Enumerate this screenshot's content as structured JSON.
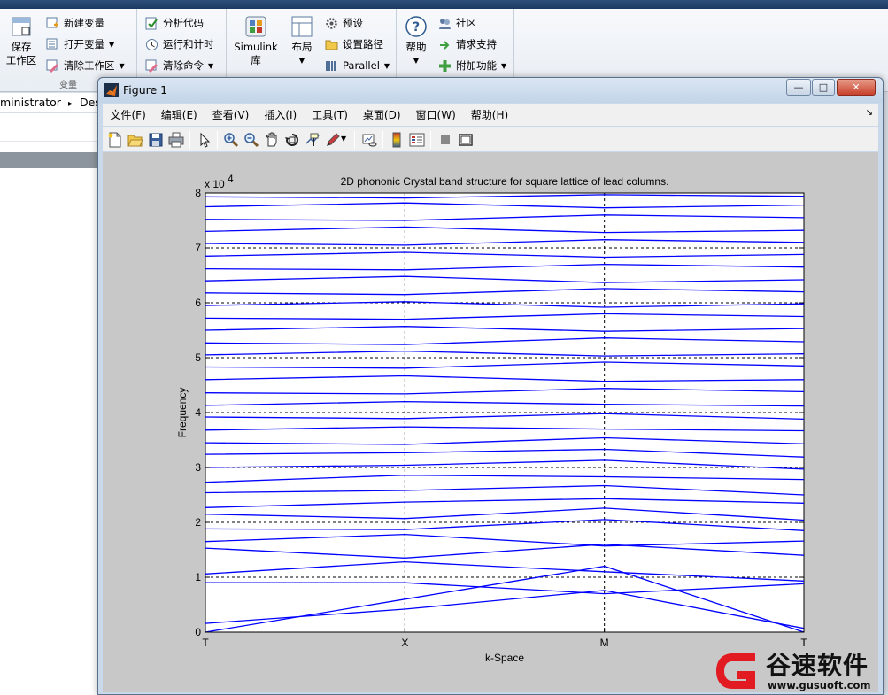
{
  "ribbon": {
    "save_workspace": "保存\n工作区",
    "new_variable": "新建变量",
    "open_variable": "打开变量",
    "clear_workspace": "清除工作区",
    "variable_group": "变量",
    "analyze_code": "分析代码",
    "run_and_time": "运行和计时",
    "clear_commands": "清除命令",
    "simulink": "Simulink",
    "simulink_lib": "库",
    "layout": "布局",
    "preferences": "预设",
    "set_path": "设置路径",
    "parallel": "Parallel",
    "help": "帮助",
    "community": "社区",
    "request_support": "请求支持",
    "addons": "附加功能"
  },
  "address": {
    "user": "ministrator",
    "separator": "▸",
    "folder": "Desk"
  },
  "figure": {
    "title": "Figure 1",
    "controls": {
      "minimize": "—",
      "maximize": "□",
      "close": "✕"
    },
    "menu": [
      "文件(F)",
      "编辑(E)",
      "查看(V)",
      "插入(I)",
      "工具(T)",
      "桌面(D)",
      "窗口(W)",
      "帮助(H)"
    ]
  },
  "icons": {
    "toolbar": [
      "new-figure-icon",
      "open-file-icon",
      "save-icon",
      "print-icon",
      "pointer-icon",
      "zoom-in-icon",
      "zoom-out-icon",
      "pan-icon",
      "rotate-3d-icon",
      "data-cursor-icon",
      "brush-icon",
      "link-plot-icon",
      "colorbar-icon",
      "legend-icon",
      "hide-tools-icon",
      "show-tools-icon"
    ]
  },
  "chart_data": {
    "type": "line",
    "title": "2D phononic Crystal band structure for square lattice of lead columns.",
    "xlabel": "k-Space",
    "ylabel": "Frequency",
    "y_exponent_label": "x 10",
    "y_exponent": "4",
    "x_ticks": [
      "T",
      "X",
      "M",
      "T"
    ],
    "y_ticks": [
      "0",
      "1",
      "2",
      "3",
      "4",
      "5",
      "6",
      "7",
      "8"
    ],
    "ylim": [
      0,
      80000
    ],
    "grid": true,
    "line_color": "#0000ff",
    "series": [
      {
        "values": [
          0,
          6000,
          12000,
          0
        ]
      },
      {
        "values": [
          1600,
          4200,
          7600,
          700
        ]
      },
      {
        "values": [
          9000,
          9000,
          7000,
          8800
        ]
      },
      {
        "values": [
          10600,
          12800,
          11000,
          9300
        ]
      },
      {
        "values": [
          15300,
          13500,
          16000,
          14000
        ]
      },
      {
        "values": [
          16500,
          17800,
          15700,
          16600
        ]
      },
      {
        "values": [
          18800,
          18700,
          20500,
          18500
        ]
      },
      {
        "values": [
          21500,
          20700,
          22600,
          20400
        ]
      },
      {
        "values": [
          22700,
          23700,
          24300,
          23500
        ]
      },
      {
        "values": [
          25400,
          25800,
          26700,
          25000
        ]
      },
      {
        "values": [
          27300,
          28600,
          28300,
          27800
        ]
      },
      {
        "values": [
          30000,
          30400,
          31300,
          29700
        ]
      },
      {
        "values": [
          32400,
          32700,
          33300,
          31900
        ]
      },
      {
        "values": [
          34500,
          34200,
          35400,
          34300
        ]
      },
      {
        "values": [
          36800,
          37400,
          37000,
          36700
        ]
      },
      {
        "values": [
          39200,
          38900,
          39800,
          38800
        ]
      },
      {
        "values": [
          41300,
          42000,
          41500,
          41200
        ]
      },
      {
        "values": [
          43600,
          43400,
          44400,
          43800
        ]
      },
      {
        "values": [
          46000,
          46700,
          45700,
          46000
        ]
      },
      {
        "values": [
          48300,
          48100,
          49200,
          48500
        ]
      },
      {
        "values": [
          50500,
          51200,
          50300,
          50700
        ]
      },
      {
        "values": [
          52700,
          52400,
          53600,
          52900
        ]
      },
      {
        "values": [
          55000,
          55700,
          54800,
          55300
        ]
      },
      {
        "values": [
          57200,
          57000,
          58000,
          57500
        ]
      },
      {
        "values": [
          59500,
          60200,
          59200,
          59800
        ]
      },
      {
        "values": [
          61800,
          61500,
          62600,
          62000
        ]
      },
      {
        "values": [
          64000,
          64800,
          63700,
          64200
        ]
      },
      {
        "values": [
          66200,
          66000,
          67000,
          66500
        ]
      },
      {
        "values": [
          68500,
          69200,
          68300,
          68800
        ]
      },
      {
        "values": [
          70800,
          70500,
          71500,
          71000
        ]
      },
      {
        "values": [
          73000,
          73800,
          72800,
          73200
        ]
      },
      {
        "values": [
          75200,
          75000,
          76000,
          75500
        ]
      },
      {
        "values": [
          77500,
          78200,
          77300,
          77800
        ]
      },
      {
        "values": [
          79300,
          79100,
          79700,
          79400
        ]
      }
    ]
  },
  "watermark": {
    "title": "谷速软件",
    "url": "www.gusuoft.com",
    "brand_color": "#e21b23"
  }
}
